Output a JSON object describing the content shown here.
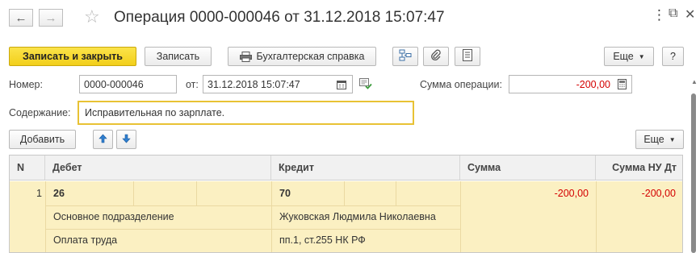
{
  "window": {
    "title": "Операция 0000-000046 от 31.12.2018 15:07:47",
    "menu_glyph": "⋮",
    "maximize_glyph": "⧉",
    "close_glyph": "✕"
  },
  "toolbar": {
    "save_close_label": "Записать и закрыть",
    "save_label": "Записать",
    "report_label": "Бухгалтерская справка",
    "more_label": "Еще",
    "help_label": "?"
  },
  "form": {
    "number_label": "Номер:",
    "number_value": "0000-000046",
    "date_label": "от:",
    "date_value": "31.12.2018 15:07:47",
    "sum_label": "Сумма операции:",
    "sum_value": "-200,00",
    "content_label": "Содержание:",
    "content_value": "Исправительная по зарплате."
  },
  "table_toolbar": {
    "add_label": "Добавить",
    "more_label": "Еще"
  },
  "table": {
    "columns": [
      "N",
      "Дебет",
      "Кредит",
      "Сумма",
      "Сумма НУ Дт"
    ],
    "rows": [
      {
        "n": "1",
        "debit_account": "26",
        "debit_subconto_1": "Основное подразделение",
        "debit_subconto_2": "Оплата труда",
        "credit_account": "70",
        "credit_subconto_1": "Жуковская Людмила Николаевна",
        "credit_subconto_2": "пп.1, ст.255 НК РФ",
        "sum": "-200,00",
        "sum_nu_dt": "-200,00"
      }
    ]
  },
  "colors": {
    "primary_button": "#f4d426",
    "selected_row": "#fbf0c2",
    "negative_amount": "#d40000",
    "focus_border": "#e8c234"
  }
}
